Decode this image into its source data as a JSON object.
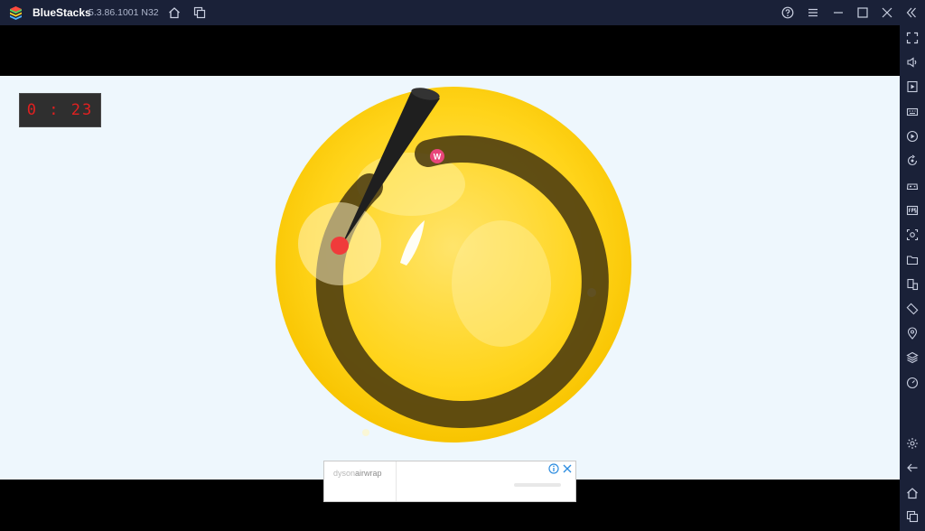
{
  "window": {
    "app_name": "BlueStacks",
    "version": "5.3.86.1001 N32"
  },
  "titlebar_icons": [
    "home-icon",
    "multi-instance-icon",
    "help-icon",
    "menu-icon",
    "minimize-icon",
    "maximize-icon",
    "close-icon",
    "collapse-sidebar-icon"
  ],
  "sidebar_icons": [
    "fullscreen-icon",
    "volume-icon",
    "media-manager-icon",
    "keymap-icon",
    "macro-icon",
    "rotate-sync-icon",
    "gamepad-icon",
    "fps-icon",
    "screenshot-icon",
    "folder-icon",
    "multi-instance-sync-icon",
    "rotate-icon",
    "location-icon",
    "layers-icon",
    "eco-mode-icon",
    "settings-icon",
    "back-icon",
    "home-icon",
    "recent-apps-icon"
  ],
  "game": {
    "timer": "0 : 23",
    "ring_marker_letter": "W"
  },
  "ad": {
    "brand_light": "dyson",
    "brand_product": "airwrap"
  },
  "colors": {
    "titlebar": "#1a2138",
    "game_background": "#eef7fd",
    "coin_yellow": "#ffd200",
    "ring": "#4a3a10",
    "timer_text": "#e02020"
  }
}
